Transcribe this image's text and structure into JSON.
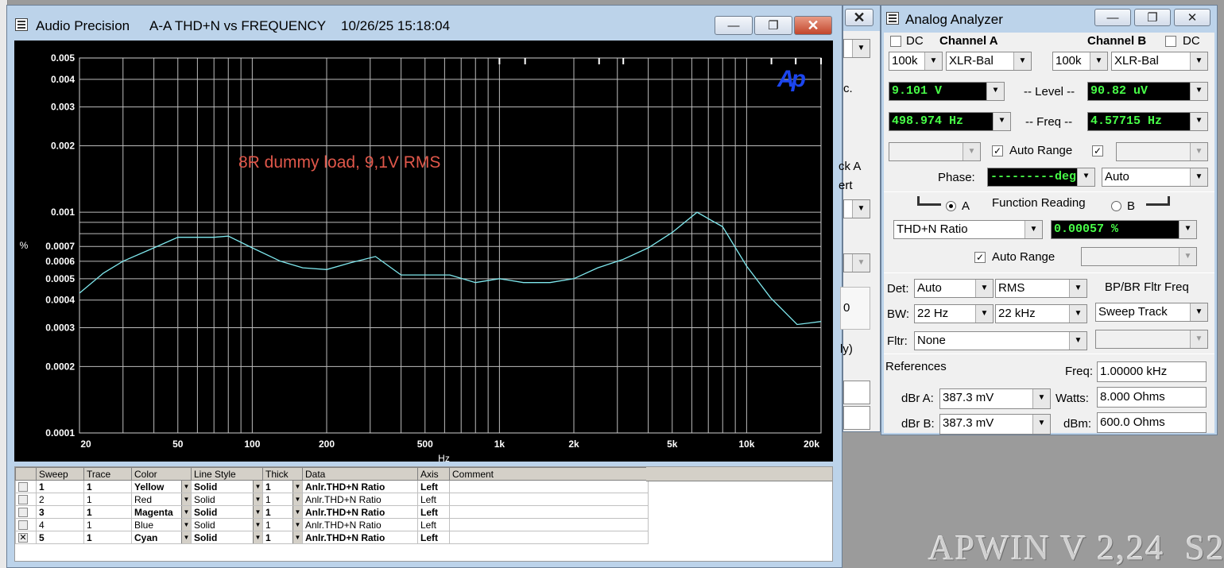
{
  "ap_window": {
    "title_app": "Audio Precision",
    "title_graph": "A-A THD+N vs FREQUENCY",
    "title_time": "10/26/25 15:18:04",
    "minimize": "—",
    "maximize": "❐",
    "close": "✕"
  },
  "chart_data": {
    "type": "line",
    "title": "",
    "annotation": "8R dummy load, 9,1V RMS",
    "logo": "Ap",
    "xlabel": "Hz",
    "ylabel": "%",
    "x_scale": "log",
    "y_scale": "log",
    "xlim": [
      20,
      20000
    ],
    "ylim": [
      0.0001,
      0.005
    ],
    "x_ticks": [
      {
        "v": 20,
        "label": "20"
      },
      {
        "v": 50,
        "label": "50"
      },
      {
        "v": 100,
        "label": "100"
      },
      {
        "v": 200,
        "label": "200"
      },
      {
        "v": 500,
        "label": "500"
      },
      {
        "v": 1000,
        "label": "1k"
      },
      {
        "v": 2000,
        "label": "2k"
      },
      {
        "v": 5000,
        "label": "5k"
      },
      {
        "v": 10000,
        "label": "10k"
      },
      {
        "v": 20000,
        "label": "20k"
      }
    ],
    "y_ticks": [
      {
        "v": 0.005,
        "label": "0.005"
      },
      {
        "v": 0.004,
        "label": "0.004"
      },
      {
        "v": 0.003,
        "label": "0.003"
      },
      {
        "v": 0.002,
        "label": "0.002"
      },
      {
        "v": 0.001,
        "label": "0.001"
      },
      {
        "v": 0.0007,
        "label": "0.0007"
      },
      {
        "v": 0.0006,
        "label": "0.0006"
      },
      {
        "v": 0.0005,
        "label": "0.0005"
      },
      {
        "v": 0.0004,
        "label": "0.0004"
      },
      {
        "v": 0.0003,
        "label": "0.0003"
      },
      {
        "v": 0.0002,
        "label": "0.0002"
      },
      {
        "v": 0.0001,
        "label": "0.0001"
      }
    ],
    "grid": true,
    "top_markers": [
      1000,
      1270,
      2530,
      3170,
      12600,
      15800,
      20000
    ],
    "series": [
      {
        "color": "#7fe8ee",
        "x": [
          20,
          25,
          30,
          40,
          50,
          60,
          70,
          80,
          100,
          130,
          160,
          200,
          250,
          315,
          400,
          500,
          630,
          800,
          1000,
          1250,
          1600,
          2000,
          2500,
          3150,
          4000,
          5000,
          6300,
          8000,
          10000,
          12500,
          16000,
          20000
        ],
        "y": [
          0.00043,
          0.00053,
          0.0006,
          0.00069,
          0.00077,
          0.00077,
          0.00077,
          0.00078,
          0.00069,
          0.0006,
          0.00056,
          0.00055,
          0.00059,
          0.00063,
          0.00052,
          0.00052,
          0.00052,
          0.00048,
          0.0005,
          0.00048,
          0.00048,
          0.0005,
          0.00056,
          0.00061,
          0.00069,
          0.00081,
          0.001,
          0.00086,
          0.00057,
          0.00041,
          0.00031,
          0.00032
        ]
      }
    ]
  },
  "sweep_table": {
    "headers": [
      "Sweep",
      "Trace",
      "Color",
      "Line Style",
      "Thick",
      "Data",
      "Axis",
      "Comment"
    ],
    "rows": [
      {
        "sweep": "1",
        "trace": "1",
        "color": "Yellow",
        "style": "Solid",
        "thick": "1",
        "data": "Anlr.THD+N Ratio",
        "axis": "Left",
        "comment": "",
        "checked": "",
        "bold": true
      },
      {
        "sweep": "2",
        "trace": "1",
        "color": "Red",
        "style": "Solid",
        "thick": "1",
        "data": "Anlr.THD+N Ratio",
        "axis": "Left",
        "comment": "",
        "checked": "",
        "bold": false
      },
      {
        "sweep": "3",
        "trace": "1",
        "color": "Magenta",
        "style": "Solid",
        "thick": "1",
        "data": "Anlr.THD+N Ratio",
        "axis": "Left",
        "comment": "",
        "checked": "",
        "bold": true
      },
      {
        "sweep": "4",
        "trace": "1",
        "color": "Blue",
        "style": "Solid",
        "thick": "1",
        "data": "Anlr.THD+N Ratio",
        "axis": "Left",
        "comment": "",
        "checked": "",
        "bold": false
      },
      {
        "sweep": "5",
        "trace": "1",
        "color": "Cyan",
        "style": "Solid",
        "thick": "1",
        "data": "Anlr.THD+N Ratio",
        "axis": "Left",
        "comment": "",
        "checked": "✕",
        "bold": true
      }
    ]
  },
  "hidden_window": {
    "close": "✕",
    "fragments": [
      "c.",
      "ck A",
      "ert",
      "0",
      "ly)"
    ]
  },
  "analyzer": {
    "title": "Analog Analyzer",
    "minimize": "—",
    "maximize": "❐",
    "close": "✕",
    "dc_label": "DC",
    "channel_a": "Channel A",
    "channel_b": "Channel B",
    "range_a": "100k",
    "input_a": "XLR-Bal",
    "range_b": "100k",
    "input_b": "XLR-Bal",
    "level_label": "-- Level --",
    "level_a": "9.101   V",
    "level_b": "90.82   uV",
    "freq_label": "-- Freq --",
    "freq_a": "498.974  Hz",
    "freq_b": "4.57715  Hz",
    "auto_range": "Auto Range",
    "phase_label": "Phase:",
    "phase_value": "---------deg",
    "phase_mode": "Auto",
    "sel_a": "A",
    "function_reading": "Function Reading",
    "sel_b": "B",
    "function": "THD+N Ratio",
    "function_value": "0.00057  %",
    "auto_range2": "Auto Range",
    "det_label": "Det:",
    "det_value": "Auto",
    "det_mode": "RMS",
    "bpbr_label": "BP/BR Fltr Freq",
    "bw_label": "BW:",
    "bw_low": "22 Hz",
    "bw_high": "22 kHz",
    "sweep_track": "Sweep Track",
    "fltr_label": "Fltr:",
    "fltr_value": "None",
    "references": "References",
    "ref_freq_label": "Freq:",
    "ref_freq": "1.00000 kHz",
    "dbra_label": "dBr A:",
    "dbra": "387.3   mV",
    "watts_label": "Watts:",
    "watts": "8.000    Ohms",
    "dbrb_label": "dBr B:",
    "dbrb": "387.3   mV",
    "dbm_label": "dBm:",
    "dbm": "600.0    Ohms"
  },
  "watermark": "APWIN V 2,24  S2"
}
